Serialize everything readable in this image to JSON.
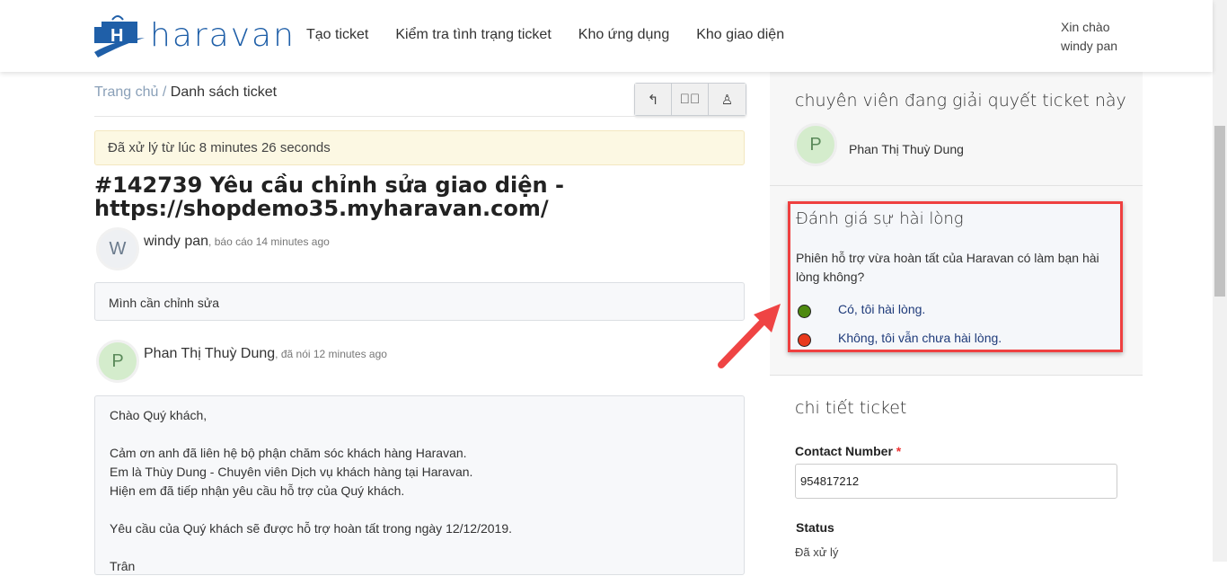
{
  "header": {
    "brand": "haravan",
    "nav": [
      "Tạo ticket",
      "Kiểm tra tình trạng ticket",
      "Kho ứng dụng",
      "Kho giao diện"
    ],
    "greeting": "Xin chào",
    "user": "windy pan"
  },
  "breadcrumb": {
    "home": "Trang chủ /",
    "current": "Danh sách ticket"
  },
  "alert": "Đã xử lý từ lúc 8 minutes 26 seconds",
  "ticket_title": "#142739 Yêu cầu chỉnh sửa giao diện - https://shopdemo35.myharavan.com/",
  "comments": [
    {
      "initial": "W",
      "name": "windy pan",
      "meta": ", báo cáo 14 minutes ago",
      "body": [
        "Mình cần chỉnh sửa"
      ]
    },
    {
      "initial": "P",
      "name": "Phan Thị Thuỳ Dung",
      "meta": ", đã nói 12 minutes ago",
      "body": [
        "Chào Quý khách,",
        "",
        "Cảm ơn anh đã liên hệ bộ phận chăm sóc khách hàng Haravan.",
        "Em là Thùy Dung - Chuyên viên Dịch vụ khách hàng tại Haravan.",
        "Hiện em đã tiếp nhận yêu cầu hỗ trợ của Quý khách.",
        "",
        "Yêu cầu của Quý khách sẽ được hỗ trợ hoàn tất trong ngày 12/12/2019.",
        "",
        "Trân"
      ]
    }
  ],
  "agent": {
    "heading": "chuyên viên đang giải quyết ticket này",
    "initial": "P",
    "name": "Phan Thị Thuỳ Dung"
  },
  "rating": {
    "heading": "Đánh giá sự hài lòng",
    "question": "Phiên hỗ trợ vừa hoàn tất của Haravan có làm bạn hài lòng không?",
    "yes": "Có, tôi hài lòng.",
    "no": "Không, tôi vẫn chưa hài lòng.",
    "yes_color": "#4e8a10",
    "no_color": "#e8391c"
  },
  "details": {
    "heading": "chi tiết ticket",
    "contact_label": "Contact Number",
    "required": "*",
    "contact_value": "954817212",
    "status_label": "Status",
    "status_value": "Đã xử lý"
  }
}
